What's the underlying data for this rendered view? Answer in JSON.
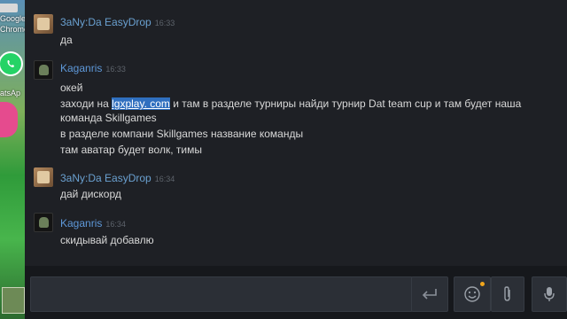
{
  "desktop": {
    "icons": [
      {
        "label": "Google"
      },
      {
        "label": "Chrome"
      },
      {
        "label": "atsAp"
      }
    ]
  },
  "messages": [
    {
      "sender": "3aNy:Da EasyDrop",
      "time": "16:33",
      "lines": [
        "да"
      ]
    },
    {
      "sender": "Kaganris",
      "time": "16:33",
      "lines": [
        "окей",
        "заходи на ",
        "lgxplay. com",
        " и там в разделе турниры найди турнир Dat team cup и там будет наша",
        "команда Skillgames",
        "в разделе компани Skillgames название команды",
        "там аватар будет волк, тимы"
      ]
    },
    {
      "sender": "3aNy:Da EasyDrop",
      "time": "16:34",
      "lines": [
        "дай дискорд"
      ]
    },
    {
      "sender": "Kaganris",
      "time": "16:34",
      "lines": [
        "скидывай добавлю"
      ]
    }
  ],
  "input": {
    "value": ""
  },
  "colors": {
    "accent": "#5e98d9",
    "highlight": "#2f6fbf",
    "notification": "#f0a51c"
  }
}
